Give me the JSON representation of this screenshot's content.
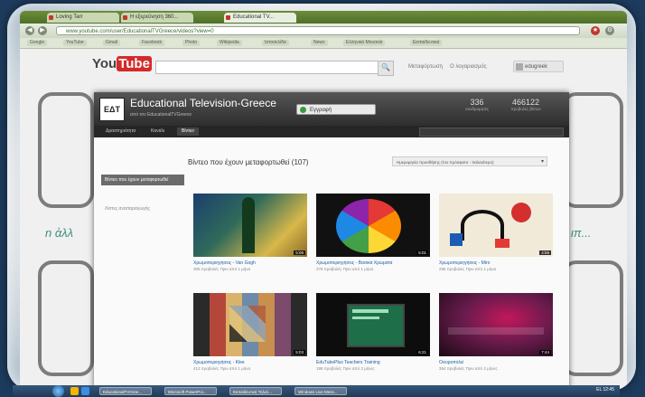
{
  "browser": {
    "tabs": [
      "Loving Tarr",
      "Η εξερεύνηση 360...",
      "Educational TV..."
    ],
    "url": "www.youtube.com/user/EducationalTVGreece/videos?view=0",
    "bookmarks": [
      "Google",
      "YouTube",
      "Gmail",
      "Facebook",
      "Photo",
      "Wikipedia",
      "Ιστοσελίδα",
      "News",
      "Ελληνικά Μουσεία",
      "Εκπαιδευτικά"
    ]
  },
  "youtube": {
    "logo_you": "You",
    "logo_tube": "Tube",
    "search_button": "🔍",
    "upload_link": "Μεταφόρτωση",
    "account_link": "Ο λογαριασμός",
    "user": "edugreek"
  },
  "channel": {
    "avatar": "EΔT",
    "title": "Educational Television-Greece",
    "subtitle": "από τον EducationalTVGreece",
    "subscribe_label": "Εγγραφή",
    "stats": [
      {
        "value": "336",
        "label": "συνδρομητές"
      },
      {
        "value": "466122",
        "label": "προβολές βίντεο"
      }
    ],
    "nav_tabs": [
      "Δραστηριότητα",
      "Κανάλι",
      "Βίντεο"
    ],
    "active_tab": 2,
    "sidebar": [
      {
        "label": "Βίντεο που έχουν μεταφορτωθεί",
        "active": true
      },
      {
        "label": "Λίστες αναπαραγωγής",
        "active": false
      }
    ],
    "section_title": "Βίντεο που έχουν μεταφορτωθεί (107)",
    "sort_label": "Ημερομηνία προσθήκης (πιο πρόσφατο - παλαιότερο)"
  },
  "videos": [
    {
      "title": "Χρωμοπεριηγήσεις - Van Gogh",
      "meta": "305 προβολές  Πριν από 1 μήνα",
      "duration": "5:09"
    },
    {
      "title": "Χρωμοπεριηγήσεις - Βασικά Χρώματα",
      "meta": "278 προβολές  Πριν από 1 μήνα",
      "duration": "5:01"
    },
    {
      "title": "Χρωμοπεριηγήσεις - Miro",
      "meta": "296 προβολές  Πριν από 1 μήνα",
      "duration": "4:59"
    },
    {
      "title": "Χρωμοπεριηγήσεις - Klee",
      "meta": "412 προβολές  Πριν από 1 μήνα",
      "duration": "5:03"
    },
    {
      "title": "EduTubePlus Teachers Training",
      "meta": "188 προβολές  Πριν από 2 μήνες",
      "duration": "6:21"
    },
    {
      "title": "Ονειροπολεί",
      "meta": "354 προβολές  Πριν από 2 μήνες",
      "duration": "7:44"
    }
  ],
  "taskbar": {
    "tasks": [
      "EducationalTVGree...",
      "Microsoft PowerPoi...",
      "Εκπαιδευτική Τηλεό...",
      "Windows Live Mess..."
    ],
    "clock": "EL  12:45"
  }
}
